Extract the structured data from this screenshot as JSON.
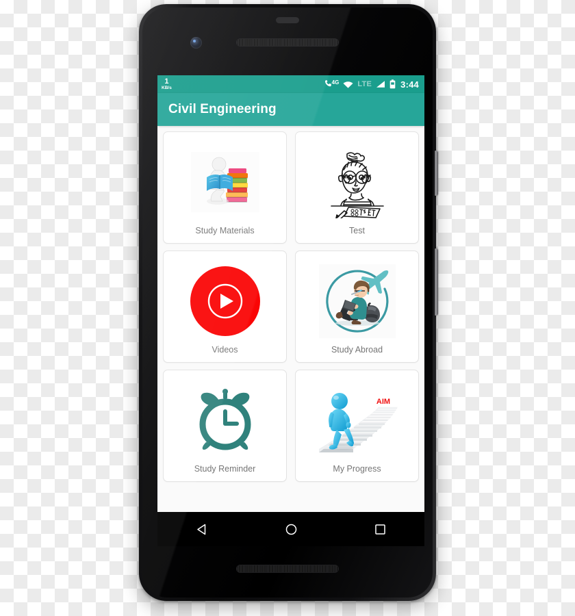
{
  "device": {
    "type": "android-smartphone",
    "frame_color": "#101012"
  },
  "status_bar": {
    "network_speed_value": "1",
    "network_speed_unit": "KB/s",
    "icons": [
      "call-4g-icon",
      "wifi-icon",
      "signal-icon",
      "battery-icon"
    ],
    "lte_label": "LTE",
    "mobile_data_label": "4G",
    "clock": "3:44",
    "background_color": "#1a9e8d",
    "text_color": "#ffffff"
  },
  "app_bar": {
    "title": "Civil Engineering",
    "background_color": "#26a699",
    "text_color": "#ffffff"
  },
  "grid": {
    "tiles": [
      {
        "label": "Study Materials",
        "icon": "student-reading-books-image"
      },
      {
        "label": "Test",
        "icon": "worried-student-test-sketch-image"
      },
      {
        "label": "Videos",
        "icon": "play-button-icon",
        "accent_color": "#fa0505"
      },
      {
        "label": "Study Abroad",
        "icon": "student-reading-airplane-image",
        "accent_color": "#3b9aa3"
      },
      {
        "label": "Study Reminder",
        "icon": "alarm-clock-icon",
        "accent_color": "#30827c"
      },
      {
        "label": "My Progress",
        "icon": "figure-climbing-stairs-image",
        "aim_label": "AIM",
        "accent_color": "#29b6e8"
      }
    ],
    "label_color": "#757575",
    "tile_background": "#ffffff",
    "page_background": "#fafafa"
  },
  "nav_bar": {
    "buttons": [
      "back-button",
      "home-button",
      "recents-button"
    ],
    "background_color": "#000000"
  }
}
